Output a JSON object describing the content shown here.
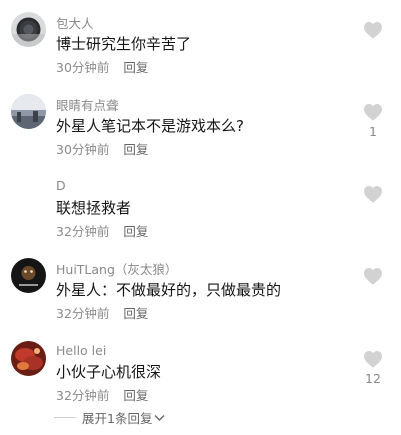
{
  "comments": [
    {
      "username": "包大人",
      "text": "博士研究生你辛苦了",
      "time": "30分钟前",
      "reply_label": "回复",
      "likes": ""
    },
    {
      "username": "眼睛有点聋",
      "text": "外星人笔记本不是游戏本么?",
      "time": "30分钟前",
      "reply_label": "回复",
      "likes": "1"
    },
    {
      "username": "D",
      "text": "联想拯救者",
      "time": "32分钟前",
      "reply_label": "回复",
      "likes": ""
    },
    {
      "username": "HuiTLang（灰太狼）",
      "text": "外星人：不做最好的，只做最贵的",
      "time": "32分钟前",
      "reply_label": "回复",
      "likes": ""
    },
    {
      "username": "Hello  lei",
      "text": "小伙子心机很深",
      "time": "32分钟前",
      "reply_label": "回复",
      "likes": "12"
    }
  ],
  "expand_label": "展开1条回复",
  "icons": {
    "like": "heart-icon",
    "expand": "chevron-down-icon"
  },
  "colors": {
    "heart": "#d2d2d2",
    "meta_text": "#8a8a8a",
    "body_text": "#161616"
  }
}
